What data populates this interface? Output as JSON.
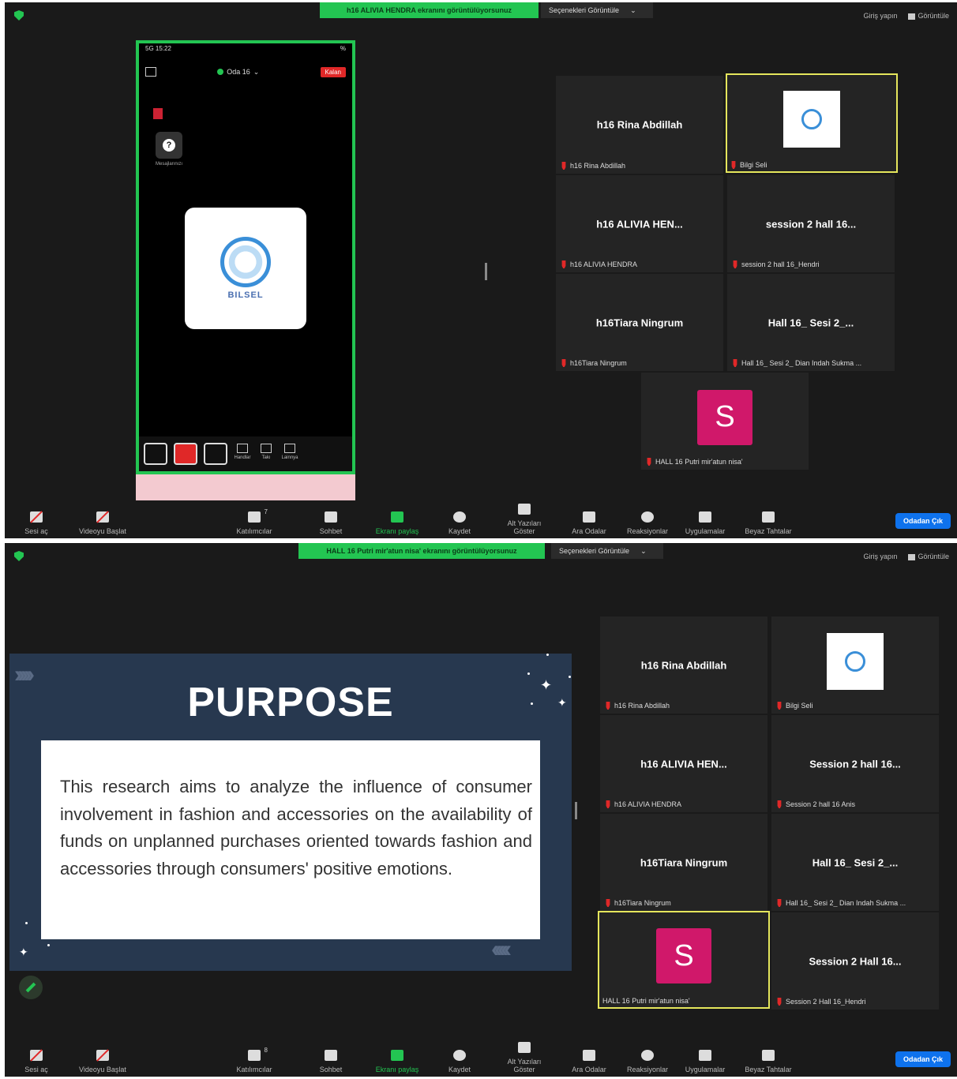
{
  "colors": {
    "share_green": "#23c552",
    "bg": "#1a1a1a",
    "tile": "#242424",
    "active_border": "#e5e65c",
    "avatar": "#d0186a",
    "leave": "#0e72ed",
    "slide_bg": "#27384f"
  },
  "shot1": {
    "share_banner": "h16 ALIVIA HENDRA ekranını görüntülüyorsunuz",
    "view_options": "Seçenekleri Görüntüle",
    "top_right": {
      "fullscreen": "Giriş yapın",
      "view": "Görüntüle"
    },
    "phone": {
      "status_left": "5G 15:22",
      "status_right": "%",
      "room": "Oda 16",
      "exit": "Kalan",
      "help_label": "Mesajlarınızı",
      "logo_text": "BILSEL",
      "toolbar_labels": [
        "Handlar",
        "Takı",
        "Lainnya"
      ]
    },
    "tiles": [
      {
        "name": "h16 Rina Abdillah",
        "label": "h16 Rina Abdillah"
      },
      {
        "name": "",
        "label": "Bilgi Seli"
      },
      {
        "name": "h16 ALIVIA HEN...",
        "label": "h16 ALIVIA HENDRA"
      },
      {
        "name": "session 2 hall 16...",
        "label": "session 2 hall 16_Hendri"
      },
      {
        "name": "h16Tiara Ningrum",
        "label": "h16Tiara Ningrum"
      },
      {
        "name": "Hall 16_ Sesi 2_...",
        "label": "Hall 16_ Sesi 2_ Dian Indah Sukma ..."
      },
      {
        "name": "S",
        "label": "HALL 16 Putri mir'atun nisa'"
      }
    ]
  },
  "shot2": {
    "share_banner": "HALL 16 Putri mir'atun nisa' ekranını görüntülüyorsunuz",
    "view_options": "Seçenekleri Görüntüle",
    "top_right": {
      "fullscreen": "Giriş yapın",
      "view": "Görüntüle"
    },
    "slide": {
      "title": "PURPOSE",
      "body": "This research aims to analyze the influence of consumer involvement in fashion and accessories on the availability of funds on unplanned purchases oriented towards fashion and accessories through consumers' positive emotions."
    },
    "tiles": [
      {
        "name": "h16 Rina Abdillah",
        "label": "h16 Rina Abdillah"
      },
      {
        "name": "",
        "label": "Bilgi Seli"
      },
      {
        "name": "h16 ALIVIA HEN...",
        "label": "h16 ALIVIA HENDRA"
      },
      {
        "name": "Session 2 hall 16...",
        "label": "Session 2 hall 16 Anis"
      },
      {
        "name": "h16Tiara Ningrum",
        "label": "h16Tiara Ningrum"
      },
      {
        "name": "Hall 16_ Sesi 2_...",
        "label": "Hall 16_ Sesi 2_ Dian Indah Sukma ..."
      },
      {
        "name": "S",
        "label": "HALL 16 Putri mir'atun nisa'"
      },
      {
        "name": "Session 2 Hall 16...",
        "label": "Session 2 Hall 16_Hendri"
      }
    ]
  },
  "toolbar": {
    "mute": "Sesi aç",
    "video": "Videoyu Başlat",
    "participants": "Katılımcılar",
    "participants_count_1": "7",
    "participants_count_2": "8",
    "chat": "Sohbet",
    "share": "Ekranı paylaş",
    "record": "Kaydet",
    "captions": "Alt Yazıları Göster",
    "breakout": "Ara Odalar",
    "reactions": "Reaksiyonlar",
    "apps": "Uygulamalar",
    "whiteboard": "Beyaz Tahtalar",
    "leave": "Odadan Çık"
  }
}
